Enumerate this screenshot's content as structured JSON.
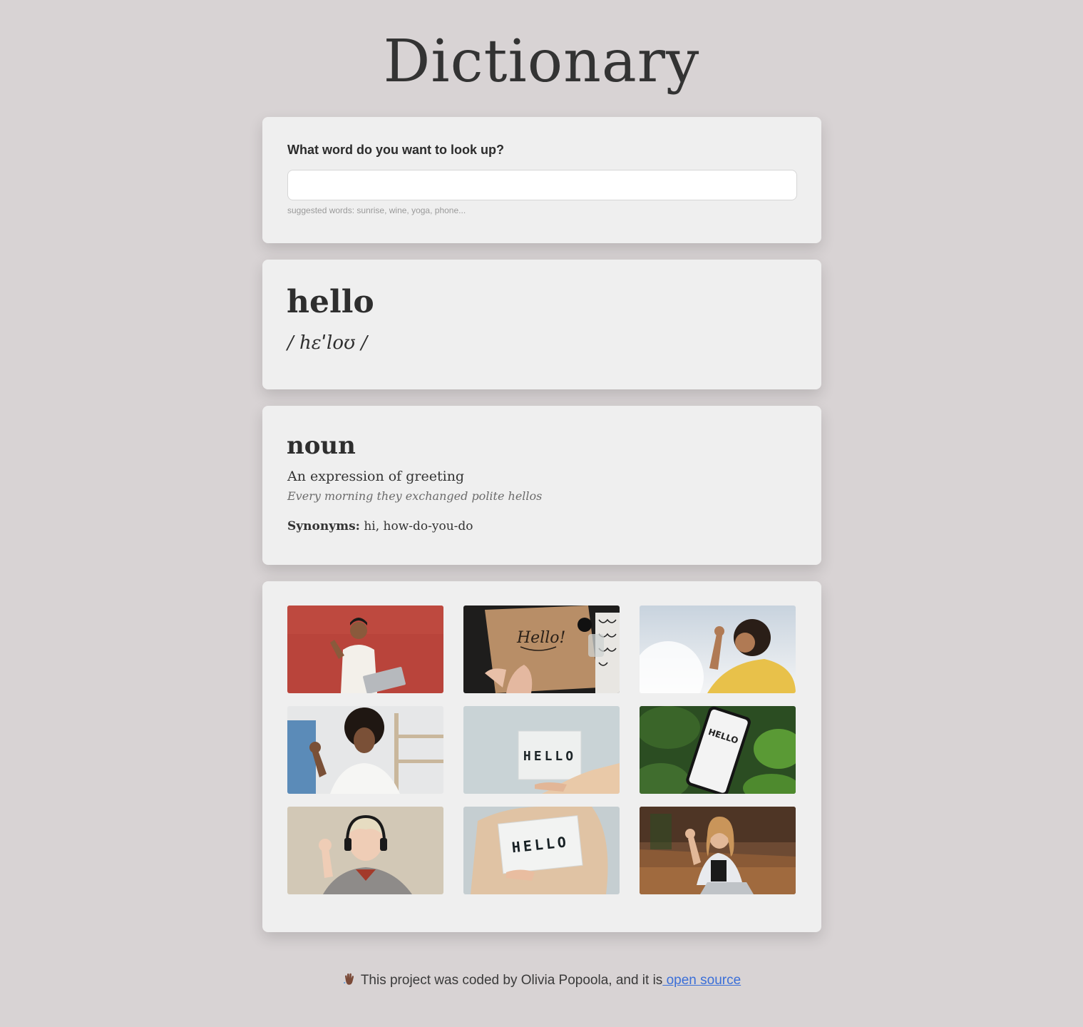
{
  "header": {
    "title": "Dictionary"
  },
  "search": {
    "label": "What word do you want to look up?",
    "value": "",
    "placeholder": "",
    "hint": "suggested words: sunrise, wine, yoga, phone..."
  },
  "word": {
    "text": "hello",
    "phonetic": "/ hɛˈloʊ /"
  },
  "meaning": {
    "part_of_speech": "noun",
    "definition": "An expression of greeting",
    "example": "Every morning they exchanged polite hellos",
    "synonyms_label": "Synonyms:",
    "synonyms": "hi, how-do-you-do"
  },
  "photos": {
    "items": [
      {
        "icon": "photo-man-waving-red-wall",
        "sign_text": ""
      },
      {
        "icon": "photo-hello-calligraphy",
        "sign_text": "Hello!"
      },
      {
        "icon": "photo-woman-waving-sky",
        "sign_text": ""
      },
      {
        "icon": "photo-girl-waving-room",
        "sign_text": ""
      },
      {
        "icon": "photo-hello-lightbox",
        "sign_text": "HELLO"
      },
      {
        "icon": "photo-hello-phone-leaves",
        "sign_text": "HELLO"
      },
      {
        "icon": "photo-person-headphones-waving",
        "sign_text": ""
      },
      {
        "icon": "photo-hello-sign-held",
        "sign_text": "HELLO"
      },
      {
        "icon": "photo-woman-laptop-waving",
        "sign_text": ""
      }
    ]
  },
  "footer": {
    "text": "This project was coded by Olivia Popoola, and it is",
    "link_label": " open source",
    "icon": "waving-hand-icon"
  },
  "colors": {
    "background": "#d8d3d4",
    "card": "#efefef",
    "link": "#3b6fd8"
  }
}
